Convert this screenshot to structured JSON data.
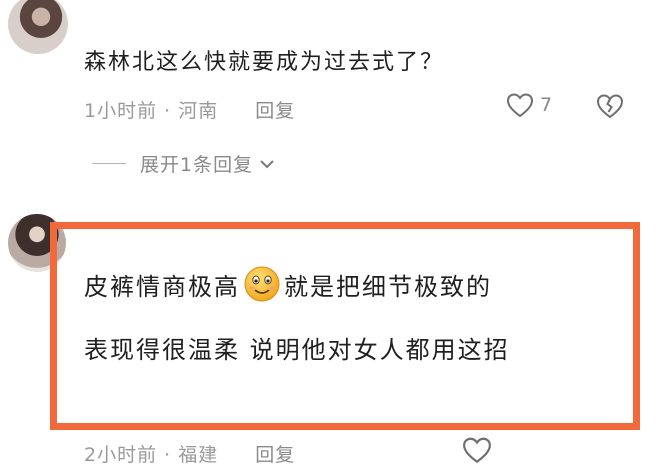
{
  "comments": [
    {
      "text": "森林北这么快就要成为过去式了？",
      "time": "1小时前",
      "region": "河南",
      "reply_label": "回复",
      "likes": "7",
      "expand_label": "展开1条回复"
    },
    {
      "line1_before": "皮裤情商极高",
      "line1_after": "就是把细节极致的",
      "line2": "表现得很温柔 说明他对女人都用这招",
      "emoji": "smile-emoji",
      "time": "2小时前",
      "region": "福建",
      "reply_label": "回复"
    }
  ],
  "meta_separator": "·",
  "colors": {
    "highlight_border": "#f26a3c",
    "meta_text": "#9a9a9a",
    "body_text": "#1f1f1f"
  }
}
